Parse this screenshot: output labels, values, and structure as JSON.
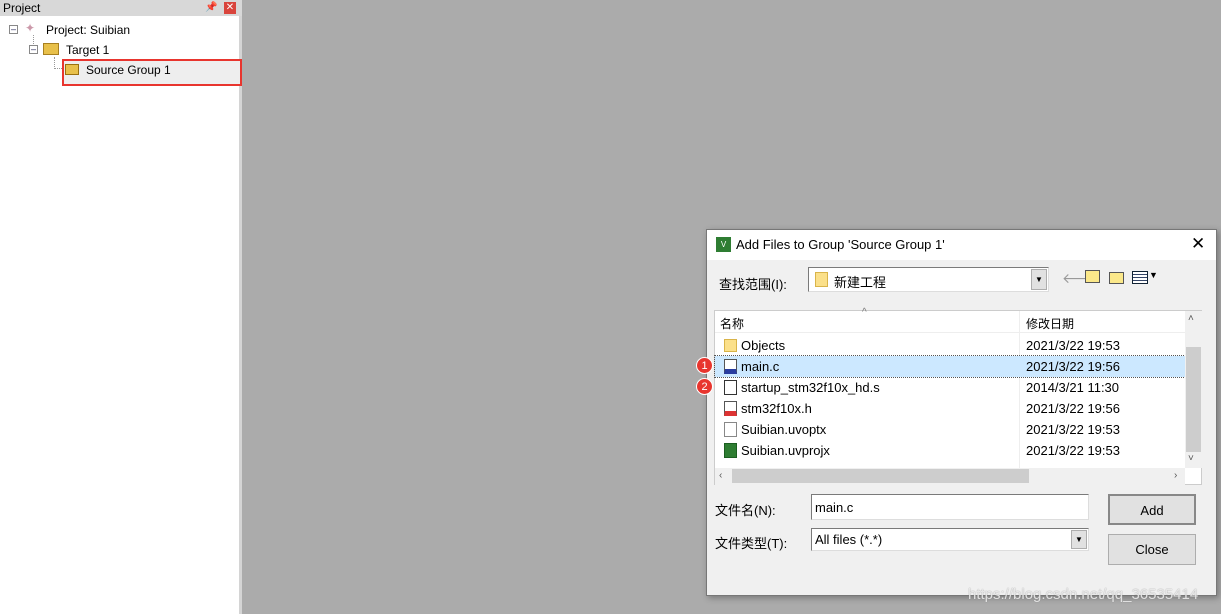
{
  "project_panel": {
    "title": "Project",
    "pin_icon": "pin-icon",
    "close_icon": "close-icon",
    "tree": {
      "project": "Project: Suibian",
      "target": "Target 1",
      "group": "Source Group 1"
    }
  },
  "dialog": {
    "title": "Add Files to Group 'Source Group 1'",
    "look_in_label": "查找范围(I):",
    "look_in_value": "新建工程",
    "columns": {
      "name": "名称",
      "date": "修改日期"
    },
    "files": [
      {
        "name": "Objects",
        "date": "2021/3/22 19:53",
        "icon": "folder-icon"
      },
      {
        "name": "main.c",
        "date": "2021/3/22 19:56",
        "icon": "c-file-icon",
        "selected": true
      },
      {
        "name": "startup_stm32f10x_hd.s",
        "date": "2014/3/21 11:30",
        "icon": "asm-file-icon"
      },
      {
        "name": "stm32f10x.h",
        "date": "2021/3/22 19:56",
        "icon": "h-file-icon"
      },
      {
        "name": "Suibian.uvoptx",
        "date": "2021/3/22 19:53",
        "icon": "file-icon"
      },
      {
        "name": "Suibian.uvprojx",
        "date": "2021/3/22 19:53",
        "icon": "uvision-icon"
      }
    ],
    "filename_label": "文件名(N):",
    "filename_value": "main.c",
    "filetype_label": "文件类型(T):",
    "filetype_value": "All files (*.*)",
    "add_label": "Add",
    "close_label": "Close"
  },
  "annotations": [
    "1",
    "2"
  ],
  "watermark": "https://blog.csdn.net/qq_36535414",
  "colors": {
    "highlight": "#e8352e",
    "selection": "#cce8ff",
    "background": "#ababab"
  }
}
